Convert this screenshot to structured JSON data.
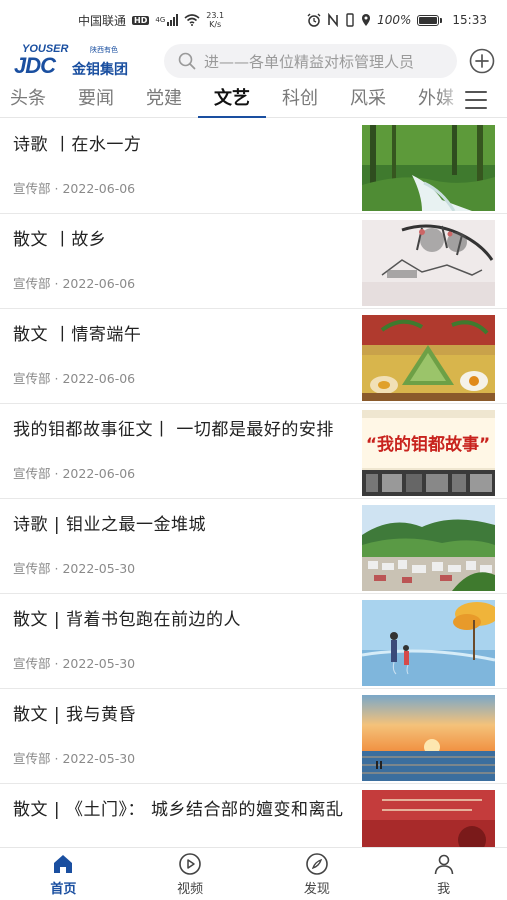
{
  "status_bar": {
    "carrier": "中国联通",
    "hd": "HD",
    "network": "4G",
    "speed_value": "23.1",
    "speed_unit": "K/s",
    "battery_percent": "100%",
    "battery_level": 1.0,
    "time": "15:33"
  },
  "header": {
    "logo_en": "YOUSER",
    "logo_sub": "陕西有色",
    "logo_abbr": "JDC",
    "logo_name": "金钼集团",
    "search_placeholder": "进——各单位精益对标管理人员"
  },
  "tabs": [
    {
      "label": "头条",
      "active": false
    },
    {
      "label": "要闻",
      "active": false
    },
    {
      "label": "党建",
      "active": false
    },
    {
      "label": "文艺",
      "active": true
    },
    {
      "label": "科创",
      "active": false
    },
    {
      "label": "风采",
      "active": false
    },
    {
      "label": "外媒",
      "active": false
    }
  ],
  "articles": [
    {
      "title": "诗歌 丨在水一方",
      "source": "宣传部",
      "date": "2022-06-06",
      "thumb": "forest-stream"
    },
    {
      "title": "散文 丨故乡",
      "source": "宣传部",
      "date": "2022-06-06",
      "thumb": "ink-painting"
    },
    {
      "title": "散文 丨情寄端午",
      "source": "宣传部",
      "date": "2022-06-06",
      "thumb": "zongzi"
    },
    {
      "title": "我的钼都故事征文丨 一切都是最好的安排",
      "source": "宣传部",
      "date": "2022-06-06",
      "thumb": "story-banner"
    },
    {
      "title": "诗歌 | 钼业之最一金堆城",
      "source": "宣传部",
      "date": "2022-05-30",
      "thumb": "mountain-town"
    },
    {
      "title": "散文 | 背着书包跑在前边的人",
      "source": "宣传部",
      "date": "2022-05-30",
      "thumb": "parent-child"
    },
    {
      "title": "散文 | 我与黄昏",
      "source": "宣传部",
      "date": "2022-05-30",
      "thumb": "sunset"
    },
    {
      "title": "散文 | 《土门》： 城乡结合部的嬗变和离乱",
      "source": "",
      "date": "",
      "thumb": "red-book"
    }
  ],
  "story_banner_text": "“我的钼都故事”",
  "meta_separator": "·",
  "bottom_nav": [
    {
      "label": "首页",
      "icon": "home-icon",
      "active": true
    },
    {
      "label": "视频",
      "icon": "play-icon",
      "active": false
    },
    {
      "label": "发现",
      "icon": "compass-icon",
      "active": false
    },
    {
      "label": "我",
      "icon": "user-icon",
      "active": false
    }
  ],
  "colors": {
    "brand": "#1a4fa0",
    "text_primary": "#222222",
    "text_secondary": "#8a8a8a",
    "divider": "#e8e8e8"
  }
}
